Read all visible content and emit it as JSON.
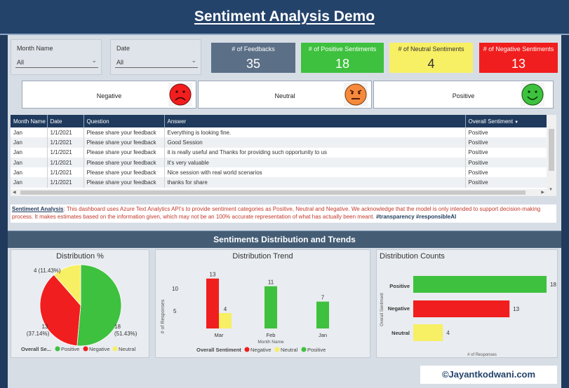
{
  "header": {
    "title": "Sentiment Analysis Demo"
  },
  "filters": {
    "month": {
      "label": "Month Name",
      "value": "All"
    },
    "date": {
      "label": "Date",
      "value": "All"
    }
  },
  "kpis": [
    {
      "label": "# of Feedbacks",
      "value": "35",
      "color": "#5b6f87"
    },
    {
      "label": "# of Positive Sentiments",
      "value": "18",
      "color": "#3ec13e"
    },
    {
      "label": "# of Neutral Sentiments",
      "value": "4",
      "color": "#f7ef64"
    },
    {
      "label": "# of Negative Sentiments",
      "value": "13",
      "color": "#f01e1e"
    }
  ],
  "sentiments": [
    {
      "label": "Negative",
      "face": "sad-face-icon",
      "color": "#f01e1e"
    },
    {
      "label": "Neutral",
      "face": "neutral-face-icon",
      "color": "#f58a3c"
    },
    {
      "label": "Positive",
      "face": "happy-face-icon",
      "color": "#3ec13e"
    }
  ],
  "table": {
    "headers": [
      "Month Name",
      "Date",
      "Question",
      "Answer",
      "Overall Sentiment"
    ],
    "rows": [
      [
        "Jan",
        "1/1/2021",
        "Please share your feedback",
        "Everything is looking fine.",
        "Positive"
      ],
      [
        "Jan",
        "1/1/2021",
        "Please share your feedback",
        "Good Session",
        "Positive"
      ],
      [
        "Jan",
        "1/1/2021",
        "Please share your feedback",
        "it is really useful and Thanks for providing such opportunity to us",
        "Positive"
      ],
      [
        "Jan",
        "1/1/2021",
        "Please share your feedback",
        "It's very valuable",
        "Positive"
      ],
      [
        "Jan",
        "1/1/2021",
        "Please share your feedback",
        "Nice session with real world scenarios",
        "Positive"
      ],
      [
        "Jan",
        "1/1/2021",
        "Please share your feedback",
        "thanks for share",
        "Positive"
      ]
    ]
  },
  "note": {
    "heading": "Sentiment Analysis",
    "body": "This dashboard uses Azure Text Analytics API's to provide sentiment categories as Positive, Neutral and Negative.  We acknowledge that the model is only intended to support decision-making process.  It makes estimates based on the information given, which may not be an 100% accurate representation of what has actually been meant.",
    "tags": "#transparency #responsibleAI"
  },
  "section": {
    "title": "Sentiments Distribution and Trends"
  },
  "chart_data": [
    {
      "type": "pie",
      "title": "Distribution %",
      "legend_title": "Overall Se...",
      "slices": [
        {
          "name": "Positive",
          "value": 18,
          "label": "18",
          "pct": "(51.43%)",
          "color": "#3ec13e"
        },
        {
          "name": "Negative",
          "value": 13,
          "label": "13",
          "pct": "(37.14%)",
          "color": "#f01e1e"
        },
        {
          "name": "Neutral",
          "value": 4,
          "label": "4 (11.43%)",
          "pct": "",
          "color": "#f7ef64"
        }
      ]
    },
    {
      "type": "bar",
      "title": "Distribution Trend",
      "xlabel": "Month Name",
      "ylabel": "# of Responses",
      "legend_title": "Overall Sentiment",
      "categories": [
        "Mar",
        "Feb",
        "Jan"
      ],
      "ylim": [
        0,
        15
      ],
      "yticks": [
        10,
        5
      ],
      "series": [
        {
          "name": "Negative",
          "color": "#f01e1e",
          "values": [
            13,
            0,
            0
          ]
        },
        {
          "name": "Neutral",
          "color": "#f7ef64",
          "values": [
            4,
            0,
            0
          ]
        },
        {
          "name": "Positive",
          "color": "#3ec13e",
          "values": [
            0,
            11,
            7
          ]
        }
      ]
    },
    {
      "type": "bar",
      "title": "Distribution Counts",
      "xlabel": "# of Responses",
      "ylabel": "Overall Sentiment",
      "categories": [
        "Positive",
        "Negative",
        "Neutral"
      ],
      "values": [
        18,
        13,
        4
      ],
      "colors": [
        "#3ec13e",
        "#f01e1e",
        "#f7ef64"
      ],
      "xlim": [
        0,
        18
      ]
    }
  ],
  "footer": {
    "credit": "©Jayantkodwani.com"
  }
}
